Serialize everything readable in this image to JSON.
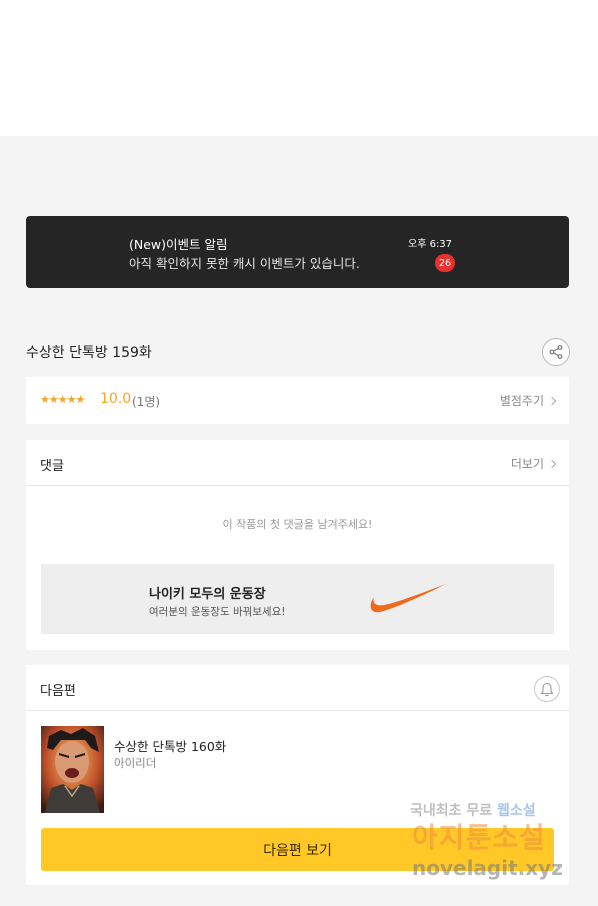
{
  "notification": {
    "title": "(New)이벤트 알림",
    "body": "아직 확인하지 못한 캐시 이벤트가 있습니다.",
    "time": "오후 6:37",
    "badge": "26"
  },
  "episode": {
    "title": "수상한 단톡방 159화",
    "share_icon": "share-icon"
  },
  "rating": {
    "stars": "★★★★★",
    "score": "10.0",
    "count": "(1명)",
    "rate_link": "별점주기",
    "star_color": "#f5a623"
  },
  "comments": {
    "label": "댓글",
    "more": "더보기",
    "empty": "이 작품의 첫 댓글을 남겨주세요!"
  },
  "ad": {
    "title": "나이키 모두의 운동장",
    "subtitle": "여러분의 운동장도 바꿔보세요!",
    "logo": "nike-swoosh-logo",
    "logo_color": "#f06a1c"
  },
  "next": {
    "label": "다음편",
    "bell_icon": "bell-icon",
    "title": "수상한 단톡방 160화",
    "author": "아이리더",
    "button": "다음편 보기",
    "button_color": "#ffc826"
  },
  "watermark": {
    "line1_a": "국내최초 무료",
    "line1_b": "웹소설",
    "line2": "아지툰소설",
    "line3": "novelagit.xyz"
  }
}
